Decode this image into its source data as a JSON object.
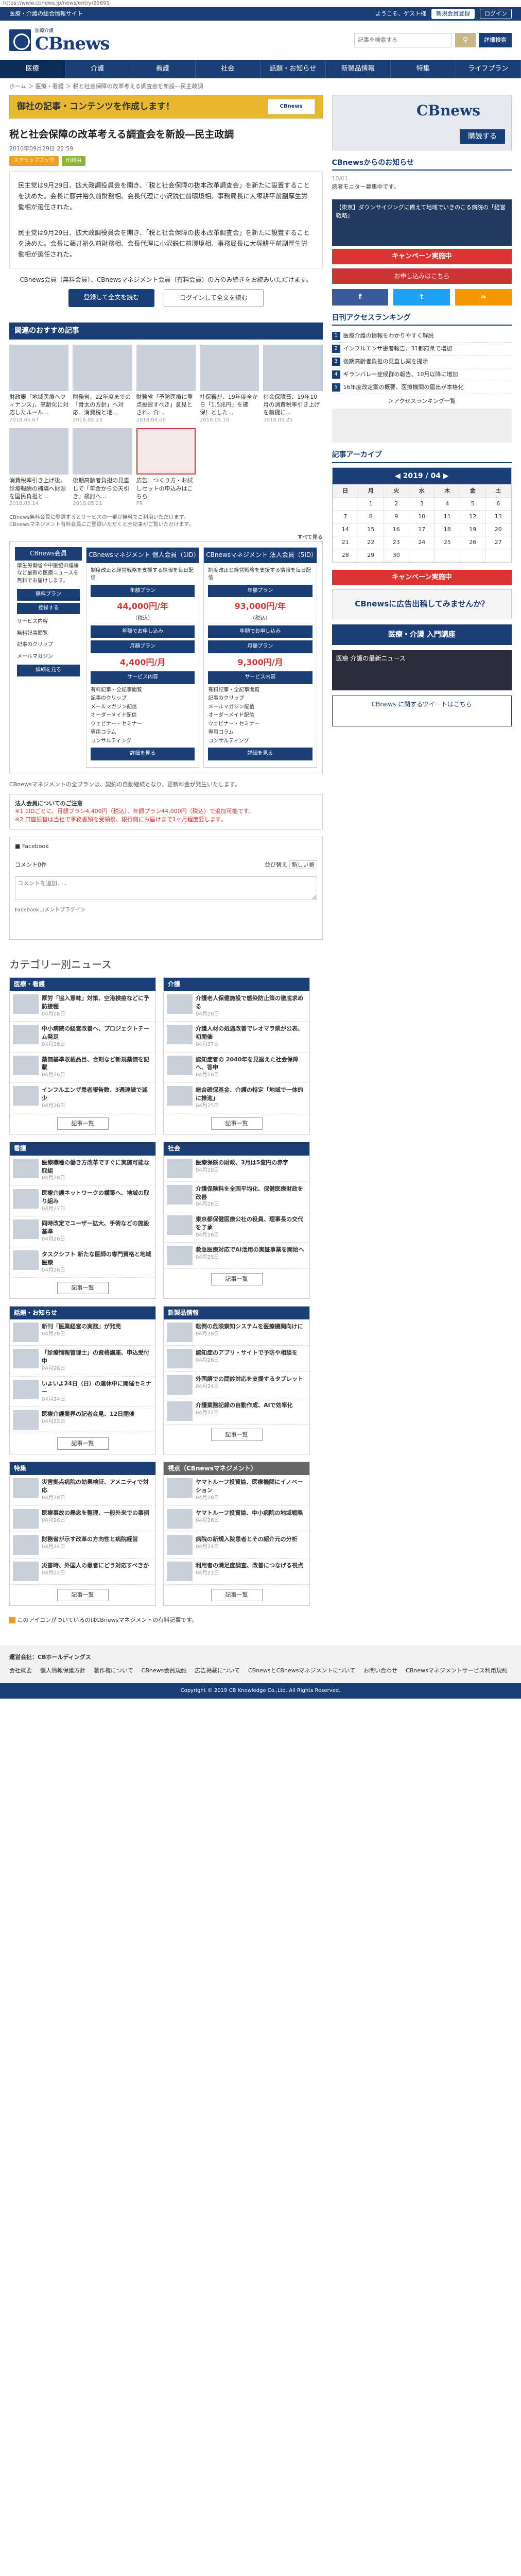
{
  "url": "https://www.cbnews.jp/news/entry/29691",
  "topbar": {
    "left": "医療・介護の総合情報サイト",
    "welcome": "ようこそ、ゲスト様",
    "register": "新規会員登録",
    "login": "ログイン"
  },
  "header": {
    "logo_sub": "医療介護",
    "logo": "CBnews",
    "search_placeholder": "記事を検索する",
    "search_icon": "search-icon",
    "detail_search": "詳細検索"
  },
  "nav": [
    "医療",
    "介護",
    "看護",
    "社会",
    "話題・お知らせ",
    "新製品情報",
    "特集",
    "ライフプラン"
  ],
  "breadcrumb": "ホーム ＞ 医療・看護 ＞ 税と社会保障の改革考える調査会を新設―民主政調",
  "banner": {
    "text": "御社の記事・コンテンツを作成します！",
    "img": "CBnews"
  },
  "article": {
    "title": "税と社会保障の改革考える調査会を新設―民主政調",
    "date": "2010年09月29日 22:59",
    "tags": [
      "スクラップブック",
      "印刷用"
    ],
    "p1": "民主党は9月29日、拡大政調役員会を開き、「税と社会保障の抜本改革調査会」を新たに設置することを決めた。会長に藤井裕久前財務相、会長代理に小沢鋭仁前環境相、事務局長に大塚耕平前副厚生労働相が選任された。",
    "p2": "民主党は9月29日、拡大政調役員会を開き、「税と社会保障の抜本改革調査会」を新たに設置することを決めた。会長に藤井裕久前財務相、会長代理に小沢鋭仁前環境相、事務局長に大塚耕平前副厚生労働相が選任された。",
    "login_note": "CBnews会員（無料会員）、CBnewsマネジメント会員（有料会員）の方のみ続きをお読みいただけます。",
    "reg_btn": "登録して全文を読む",
    "login_btn": "ログインして全文を読む"
  },
  "recommend": {
    "title": "関連のおすすめ記事",
    "items": [
      {
        "t": "財政審「地域医療ヘフィナンス」、高齢化に対応したルール...",
        "d": "2018.05.07"
      },
      {
        "t": "財務省、22年度までの「骨太の方針」へ対応、消費税と地...",
        "d": "2018.05.23"
      },
      {
        "t": "財務省「予防医療に重点投資すべき」意見とされ、介...",
        "d": "2018.04.06"
      },
      {
        "t": "社保審が、19年度全から「1.5兆円」を確保！とした...",
        "d": "2018.05.10"
      },
      {
        "t": "社会保障費、19年10月の消費税率引き上げを前提に...",
        "d": "2018.05.25"
      },
      {
        "t": "消費税率引き上げ後、診療報酬の補填へ財源を国民負担と...",
        "d": "2018.05.14"
      },
      {
        "t": "後期高齢者負担の見直しで「年金からの天引き」検討へ...",
        "d": "2018.05.21"
      },
      {
        "t": "広告：つくり方・お試しセットの申込みはこちら",
        "d": "PR"
      }
    ]
  },
  "plans": {
    "note1": "CBnews無料会員に登録するとサービスの一部が無料でご利用いただけます。",
    "note2": "CBnewsマネジメント有料会員にご登録いただくと全記事がご覧いただけます。",
    "more": "すべて見る",
    "side_title": "CBnews会員",
    "side_text": "厚生労働省や中医協の議論など最新の医療ニュースを無料でお届けします。",
    "free_label": "無料プラン",
    "free_btn": "登録する",
    "service_title": "サービス内容",
    "side_services": [
      "無料記事閲覧",
      "記事のクリップ",
      "メールマガジン"
    ],
    "detail_btn": "詳細を見る",
    "items": [
      {
        "name": "CBnewsマネジメント 個人会員（1ID）",
        "lead": "制度改正と経営戦略を支援する情報を毎日配信",
        "plan": "年額プラン",
        "price": "44,000円/年",
        "tax": "（税込）",
        "buy": "年額でお申し込み",
        "sub": "月額プラン",
        "subprice": "4,400円/月"
      },
      {
        "name": "CBnewsマネジメント 法人会員（5ID）",
        "lead": "制度改正と経営戦略を支援する情報を毎日配信",
        "plan": "年額プラン",
        "price": "93,000円/年",
        "tax": "（税込）",
        "buy": "年額でお申し込み",
        "sub": "月額プラン",
        "subprice": "9,300円/月"
      }
    ],
    "plan_services": [
      "有料記事・全記事閲覧",
      "記事のクリップ",
      "メールマガジン配信",
      "オーダーメイド配信",
      "ウェビナー・セミナー",
      "専用コラム",
      "コンサルティング"
    ]
  },
  "cbm_note": "CBnewsマネジメントの全プランは、契約の自動継続となり、更新料金が発生いたします。",
  "warn": {
    "title": "法人会員についてのご注意",
    "line1": "※1 1IDごとに、月額プラン4,400円（税込）、年額プラン44,000円（税込）で追加可能です。",
    "line2": "※2 口座振替は当社で事務書類を受領後、銀行側にお届けまで1ヶ月程度要します。"
  },
  "facebook": {
    "label": "Facebook",
    "count": "コメント0件",
    "sort": "並び替え",
    "sort_val": "新しい順",
    "placeholder": "コメントを追加...",
    "plugin": "Facebookコメントプラグイン"
  },
  "side": {
    "ad_brand": "CBnews",
    "ad_buy": "購読する",
    "info_title": "CBnewsからのお知らせ",
    "info_date": "10/01",
    "info_text": "読者モニター募集中です。",
    "seminar": "【東京】ダウンサイジングに備えて地域でいきのこる病院の「経営戦略」",
    "kakaku": "キャンペーン実施中",
    "red_ban": "お申し込みはこちら",
    "rank_title": "日刊アクセスランキング",
    "ranks": [
      "医療介護の情報をわかりやすく解説",
      "インフルエンザ患者報告、31都府県で増加",
      "後期高齢者負担の見直し案を提示",
      "ギランバレー症候群の報告、10月以降に増加",
      "16年度改定案の概要、医療機関の届出が本格化"
    ],
    "rank_more": "＞アクセスランキング一覧",
    "archive_title": "記事アーカイブ",
    "month": "2019 / 04",
    "weekdays": [
      "日",
      "月",
      "火",
      "水",
      "木",
      "金",
      "土"
    ],
    "cal_weeks": [
      [
        "",
        "1",
        "2",
        "3",
        "4",
        "5",
        "6"
      ],
      [
        "7",
        "8",
        "9",
        "10",
        "11",
        "12",
        "13"
      ],
      [
        "14",
        "15",
        "16",
        "17",
        "18",
        "19",
        "20"
      ],
      [
        "21",
        "22",
        "23",
        "24",
        "25",
        "26",
        "27"
      ],
      [
        "28",
        "29",
        "30",
        "",
        "",
        "",
        ""
      ]
    ],
    "campaign": "キャンペーン実施中",
    "wide_ad": "CBnewsに広告出稿してみませんか？",
    "blue_ban": "医療・介護 入門講座",
    "dark_ad": "医療 介護の最新ニュース",
    "notify": "CBnews に関するツイートはこちら"
  },
  "categories": {
    "title": "カテゴリー別ニュース",
    "more": "記事一覧",
    "boxes": [
      {
        "h": "医療・看護",
        "items": [
          [
            "厚労「協入意味」対策、空港検疫などに予防接種",
            "04月28日"
          ],
          [
            "中小病院の経営改善へ、プロジェクトチーム発足",
            "04月26日"
          ],
          [
            "薬価基準収載品目、合剤など新規薬価を記載",
            "04月26日"
          ],
          [
            "インフルエンザ患者報告数、3週連続で減少",
            "04月26日"
          ]
        ]
      },
      {
        "h": "介護",
        "items": [
          [
            "介護老人保健施設で感染防止策の徹底求める",
            "04月28日"
          ],
          [
            "介護人材の処遇改善でレオマラ県が公表、初開催",
            "04月27日"
          ],
          [
            "認知症者の 2040年を見据えた社会保障へ、答申",
            "04月26日"
          ],
          [
            "総合確保基金、介護の特定「地域で一体的に推進」",
            "04月25日"
          ]
        ]
      },
      {
        "h": "看護",
        "items": [
          [
            "医療職種の働き方改革ですぐに実施可能な取組",
            "04月28日"
          ],
          [
            "医療介護ネットワークの構築へ、地域の取り組み",
            "04月27日"
          ],
          [
            "同時改定でユーザー拡大、手術などの施設基準",
            "04月26日"
          ],
          [
            "タスクシフト 新たな医師の専門資格と地域医療",
            "04月26日"
          ]
        ]
      },
      {
        "h": "社会",
        "items": [
          [
            "医療保険の財政、3月は5億円の赤字",
            "04月28日"
          ],
          [
            "介護保険料を全国平均化、保健医療財政を改善",
            "04月26日"
          ],
          [
            "東京都保健医療公社の役員、理事長の交代を了承",
            "04月26日"
          ],
          [
            "救急医療対応でAI活用の実証事業を開始へ",
            "04月25日"
          ]
        ]
      },
      {
        "h": "話題・お知らせ",
        "items": [
          [
            "新刊「医業経営の実務」が発売",
            "04月28日"
          ],
          [
            "「診療情報管理士」の資格講座、申込受付中",
            "04月26日"
          ],
          [
            "いよいよ24日（日）の連休中に開催セミナー",
            "04月24日"
          ],
          [
            "医療介護業界の記者会見、12日開催",
            "04月22日"
          ]
        ]
      },
      {
        "h": "新製品情報",
        "items": [
          [
            "転倒の危険察知システムを医療機関向けに",
            "04月28日"
          ],
          [
            "認知症のアプリ・サイトで予防や相談を",
            "04月26日"
          ],
          [
            "外国語での問診対応を支援するタブレット",
            "04月24日"
          ],
          [
            "介護業務記録の自動作成、AIで効率化",
            "04月22日"
          ]
        ]
      },
      {
        "h": "特集",
        "items": [
          [
            "災害拠点病院の効果検証、アメニティで対応",
            "04月28日"
          ],
          [
            "医療事故の懸念を整理、一般外来での事例",
            "04月26日"
          ],
          [
            "財務省が示す改革の方向性と病院経営",
            "04月24日"
          ],
          [
            "災害時、外国人の患者にどう対応すべきか",
            "04月22日"
          ]
        ]
      },
      {
        "h": "視点（CBnewsマネジメント）",
        "items": [
          [
            "ヤマトルーフ投資論、医療機関にイノベーション",
            "04月28日"
          ],
          [
            "ヤマトルーフ投資論、中小病院の地域戦略",
            "04月26日"
          ],
          [
            "病院の新規入院患者とその紹介元の分析",
            "04月24日"
          ],
          [
            "利用者の満足度調査、改善につなげる視点",
            "04月22日"
          ]
        ]
      }
    ]
  },
  "footer_note": "このアイコンがついているのはCBnewsマネジメントの有料記事です。",
  "footer": {
    "company": "運営会社：CBホールディングス",
    "links": [
      "会社概要",
      "個人情報保護方針",
      "著作権について",
      "CBnews会員規約",
      "広告掲載について",
      "CBnewsとCBnewsマネジメントについて",
      "お問い合わせ",
      "CBnewsマネジメントサービス利用規約"
    ],
    "copy": "Copyright © 2019 CB Knowledge Co.,Ltd. All Rights Reserved."
  }
}
